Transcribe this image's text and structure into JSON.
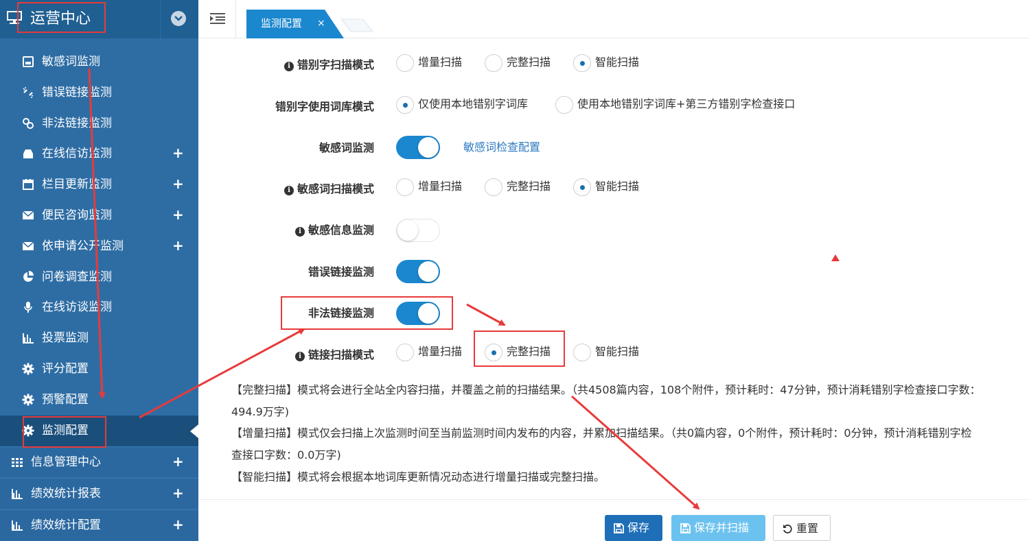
{
  "sidebar": {
    "title": "运营中心",
    "items": [
      {
        "label": "敏感词监测",
        "icon": "archive-icon"
      },
      {
        "label": "错误链接监测",
        "icon": "broken-link-icon"
      },
      {
        "label": "非法链接监测",
        "icon": "link-icon"
      },
      {
        "label": "在线信访监测",
        "icon": "inbox-icon",
        "expand": "+"
      },
      {
        "label": "栏目更新监测",
        "icon": "calendar-icon",
        "expand": "+"
      },
      {
        "label": "便民咨询监测",
        "icon": "envelope-icon",
        "expand": "+"
      },
      {
        "label": "依申请公开监测",
        "icon": "envelope-icon",
        "expand": "+"
      },
      {
        "label": "问卷调查监测",
        "icon": "pie-chart-icon"
      },
      {
        "label": "在线访谈监测",
        "icon": "microphone-icon"
      },
      {
        "label": "投票监测",
        "icon": "bar-chart-icon"
      },
      {
        "label": "评分配置",
        "icon": "gear-icon"
      },
      {
        "label": "预警配置",
        "icon": "gear-icon"
      },
      {
        "label": "监测配置",
        "icon": "gear-icon",
        "active": true
      }
    ],
    "top_items": [
      {
        "label": "信息管理中心",
        "icon": "grid-icon",
        "expand": "+"
      },
      {
        "label": "绩效统计报表",
        "icon": "bar-chart-icon",
        "expand": "+"
      },
      {
        "label": "绩效统计配置",
        "icon": "bar-chart-icon",
        "expand": "+"
      }
    ]
  },
  "tabs": [
    {
      "label": "监测配置",
      "close": "×",
      "active": true
    }
  ],
  "form": {
    "typo_scan_mode": {
      "label": "错别字扫描模式",
      "options": [
        "增量扫描",
        "完整扫描",
        "智能扫描"
      ],
      "selected": "智能扫描"
    },
    "typo_dict_mode": {
      "label": "错别字使用词库模式",
      "options": [
        "仅使用本地错别字词库",
        "使用本地错别字词库+第三方错别字检查接口"
      ],
      "selected": "仅使用本地错别字词库"
    },
    "sensitive_word": {
      "label": "敏感词监测",
      "enabled": true,
      "link": "敏感词检查配置"
    },
    "sensitive_scan_mode": {
      "label": "敏感词扫描模式",
      "options": [
        "增量扫描",
        "完整扫描",
        "智能扫描"
      ],
      "selected": "智能扫描"
    },
    "sensitive_info": {
      "label": "敏感信息监测",
      "enabled": false
    },
    "error_link": {
      "label": "错误链接监测",
      "enabled": true
    },
    "illegal_link": {
      "label": "非法链接监测",
      "enabled": true
    },
    "link_scan_mode": {
      "label": "链接扫描模式",
      "options": [
        "增量扫描",
        "完整扫描",
        "智能扫描"
      ],
      "selected": "完整扫描"
    }
  },
  "descriptions": [
    "【完整扫描】模式将会进行全站全内容扫描，并覆盖之前的扫描结果。（共4508篇内容，108个附件，预计耗时：47分钟，预计消耗错别字检查接口字数：",
    "494.9万字)",
    "【增量扫描】模式仅会扫描上次监测时间至当前监测时间内发布的内容，并累加扫描结果。（共0篇内容，0个附件，预计耗时：0分钟，预计消耗错别字检",
    "查接口字数：0.0万字)",
    "【智能扫描】模式将会根据本地词库更新情况动态进行增量扫描或完整扫描。"
  ],
  "buttons": {
    "save": "保存",
    "save_scan": "保存并扫描",
    "reset": "重置"
  },
  "colors": {
    "sidebar": "#2e6da4",
    "primary": "#1b87cf",
    "annotation": "#e83a3a"
  }
}
